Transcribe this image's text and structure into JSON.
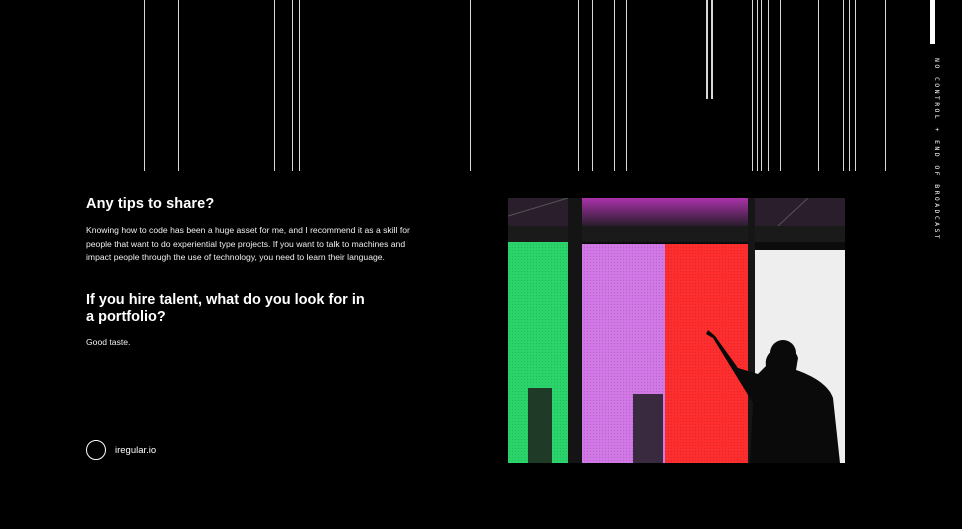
{
  "side_text": "NO CONTROL + END OF BROADCAST",
  "tips": {
    "question": "Any tips to share?",
    "answer": "Knowing how to code has been a huge asset for me, and I recommend it as a skill for people that want to do experiential type projects. If you want to talk to machines and impact people through the use of technology, you need to learn their language."
  },
  "portfolio": {
    "question": "If you hire talent, what do you look for in a portfolio?",
    "answer": "Good taste."
  },
  "site": {
    "label": "iregular.io"
  },
  "photo": {
    "icon": "silhouette-led-wall-photo"
  }
}
